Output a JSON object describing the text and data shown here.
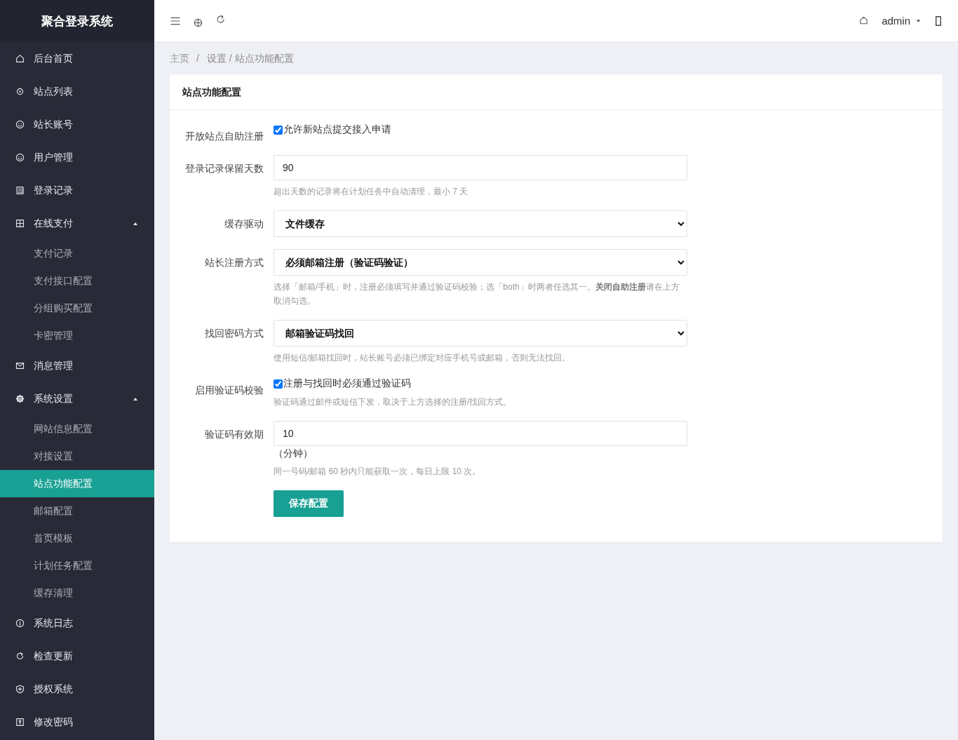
{
  "sidebar": {
    "title": "聚合登录系统",
    "items": [
      {
        "label": "后台首页",
        "selected": false
      },
      {
        "label": "站点列表",
        "selected": false
      },
      {
        "label": "站长账号",
        "selected": false
      },
      {
        "label": "用户管理",
        "selected": false
      },
      {
        "label": "登录记录",
        "selected": false
      },
      {
        "label": "在线支付",
        "selected": false,
        "expanded": true,
        "children": [
          {
            "label": "支付记录",
            "selected": false
          },
          {
            "label": "支付接口配置",
            "selected": false
          },
          {
            "label": "分组购买配置",
            "selected": false
          },
          {
            "label": "卡密管理",
            "selected": false
          }
        ]
      },
      {
        "label": "消息管理",
        "selected": false
      },
      {
        "label": "系统设置",
        "selected": false,
        "expanded": true,
        "children": [
          {
            "label": "网站信息配置",
            "selected": false
          },
          {
            "label": "对接设置",
            "selected": false
          },
          {
            "label": "站点功能配置",
            "selected": true
          },
          {
            "label": "邮箱配置",
            "selected": false
          },
          {
            "label": "首页模板",
            "selected": false
          },
          {
            "label": "计划任务配置",
            "selected": false
          },
          {
            "label": "缓存清理",
            "selected": false
          }
        ]
      },
      {
        "label": "系统日志",
        "selected": false
      },
      {
        "label": "检查更新",
        "selected": false
      },
      {
        "label": "授权系统",
        "selected": false
      },
      {
        "label": "修改密码",
        "selected": false
      }
    ]
  },
  "header": {
    "user": "admin"
  },
  "breadcrumb": {
    "items": [
      "主页",
      "设置 / 站点功能配置"
    ],
    "separator": "/"
  },
  "card": {
    "title": "站点功能配置",
    "fields": [
      {
        "kind": "checkbox",
        "label": "开放站点自助注册",
        "text": "允许新站点提交接入申请",
        "checked": true
      },
      {
        "kind": "input",
        "label": "登录记录保留天数",
        "value": "90",
        "hint": "超出天数的记录将在计划任务中自动清理，最小 7 天"
      },
      {
        "kind": "select",
        "label": "缓存驱动",
        "value": "文件缓存"
      },
      {
        "kind": "select",
        "label": "站长注册方式",
        "value": "必须邮箱注册（验证码验证）",
        "hint": "选择「邮箱/手机」时，注册必须填写并通过验证码校验；选「both」时两者任选其一。**关闭自助注册**请在上方取消勾选。"
      },
      {
        "kind": "select",
        "label": "找回密码方式",
        "value": "邮箱验证码找回",
        "hint": "使用短信/邮箱找回时，站长账号必须已绑定对应手机号或邮箱，否则无法找回。"
      },
      {
        "kind": "checkbox",
        "label": "启用验证码校验",
        "text": "注册与找回时必须通过验证码",
        "checked": true,
        "hint": "验证码通过邮件或短信下发，取决于上方选择的注册/找回方式。"
      },
      {
        "kind": "input",
        "label": "验证码有效期",
        "value": "10",
        "unit": "（分钟）",
        "hint": "同一号码/邮箱 60 秒内只能获取一次，每日上限 10 次。"
      }
    ],
    "submit": "保存配置"
  }
}
